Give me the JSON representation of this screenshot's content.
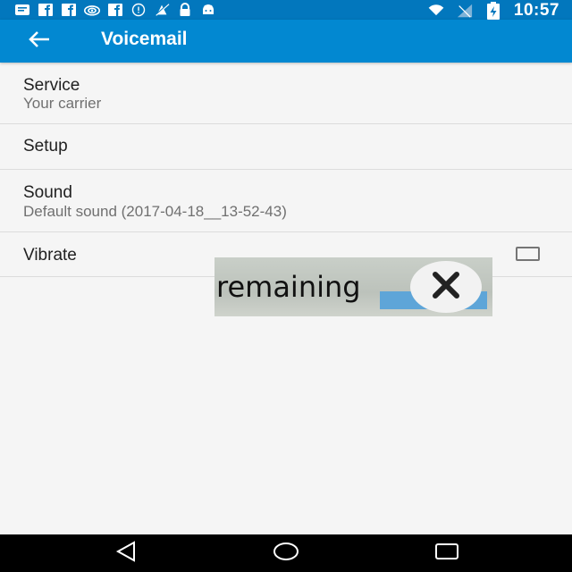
{
  "status_bar": {
    "time": "10:57",
    "left_icons": [
      "message-icon",
      "facebook-icon",
      "facebook-icon",
      "wifi-hotspot-icon",
      "facebook-icon",
      "alert-icon",
      "no-location-icon",
      "lock-icon",
      "android-icon"
    ],
    "right_icons": [
      "wifi-icon",
      "no-signal-icon",
      "battery-charging-icon"
    ]
  },
  "app_bar": {
    "title": "Voicemail",
    "back_icon": "arrow-back-icon",
    "color": "#0288d1"
  },
  "settings": {
    "service": {
      "title": "Service",
      "summary": "Your carrier"
    },
    "setup": {
      "title": "Setup"
    },
    "sound": {
      "title": "Sound",
      "summary": "Default sound (2017-04-18__13-52-43)"
    },
    "vibrate": {
      "title": "Vibrate",
      "checked": false
    }
  },
  "overlay": {
    "text": "remaining",
    "close_icon": "close-icon"
  },
  "nav_bar": {
    "icons": [
      "back-icon",
      "home-icon",
      "recents-icon"
    ]
  }
}
